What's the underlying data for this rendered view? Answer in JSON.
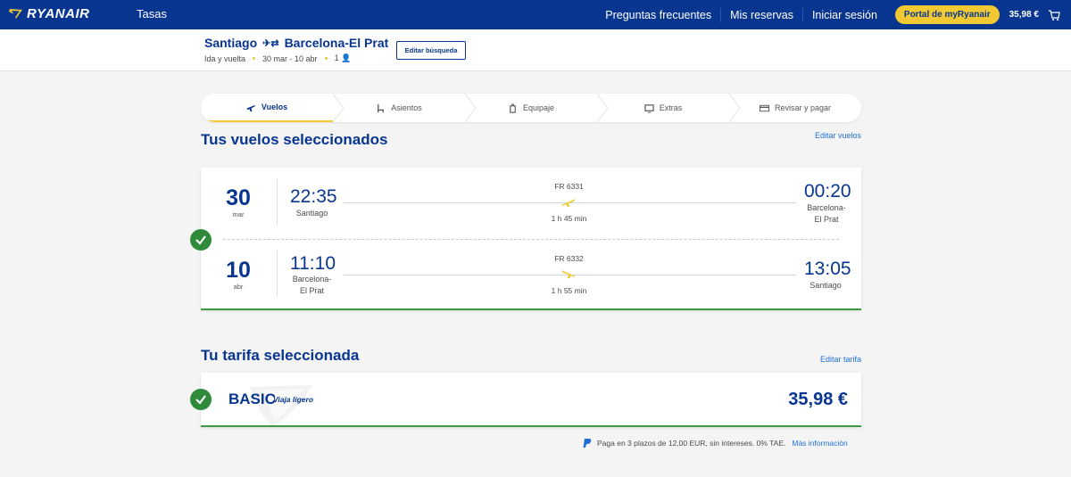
{
  "nav": {
    "logo": "RYANAIR",
    "tasas": "Tasas",
    "faq": "Preguntas frecuentes",
    "bookings": "Mis reservas",
    "login": "Iniciar sesión",
    "portal": "Portal de myRyanair",
    "price": "35,98 €",
    "cart_count": "0"
  },
  "search": {
    "origin": "Santiago",
    "destination": "Barcelona-El Prat",
    "trip_type": "Ida y vuelta",
    "dates": "30 mar - 10 abr",
    "passengers": "1",
    "edit_label": "Editar búsqueda"
  },
  "steps": [
    {
      "label": "Vuelos",
      "icon": "plane-icon",
      "active": true
    },
    {
      "label": "Asientos",
      "icon": "seat-icon",
      "active": false
    },
    {
      "label": "Equipaje",
      "icon": "luggage-icon",
      "active": false
    },
    {
      "label": "Extras",
      "icon": "extras-icon",
      "active": false
    },
    {
      "label": "Revisar y pagar",
      "icon": "card-icon",
      "active": false
    }
  ],
  "flights_section": {
    "title": "Tus vuelos seleccionados",
    "edit_label": "Editar vuelos"
  },
  "flights": [
    {
      "day": "30",
      "month": "mar",
      "dep_time": "22:35",
      "dep_city": "Santiago",
      "flight_no": "FR 6331",
      "duration": "1 h 45 min",
      "arr_time": "00:20",
      "arr_city_1": "Barcelona-",
      "arr_city_2": "El Prat"
    },
    {
      "day": "10",
      "month": "abr",
      "dep_time": "11:10",
      "dep_city_1": "Barcelona-",
      "dep_city_2": "El Prat",
      "flight_no": "FR 6332",
      "duration": "1 h 55 min",
      "arr_time": "13:05",
      "arr_city": "Santiago"
    }
  ],
  "fare_section": {
    "title": "Tu tarifa seleccionada",
    "edit_label": "Editar tarifa"
  },
  "fare": {
    "name": "BASIC",
    "description": "Viaja ligero",
    "price": "35,98 €"
  },
  "installments": {
    "text": "Paga en 3 plazos de 12,00 EUR, sin intereses. 0% TAE.",
    "link": "Más información"
  },
  "colors": {
    "brand_blue": "#073590",
    "accent_yellow": "#f1c933",
    "success_green": "#2f8a3a",
    "link_blue": "#1e6fd9"
  }
}
